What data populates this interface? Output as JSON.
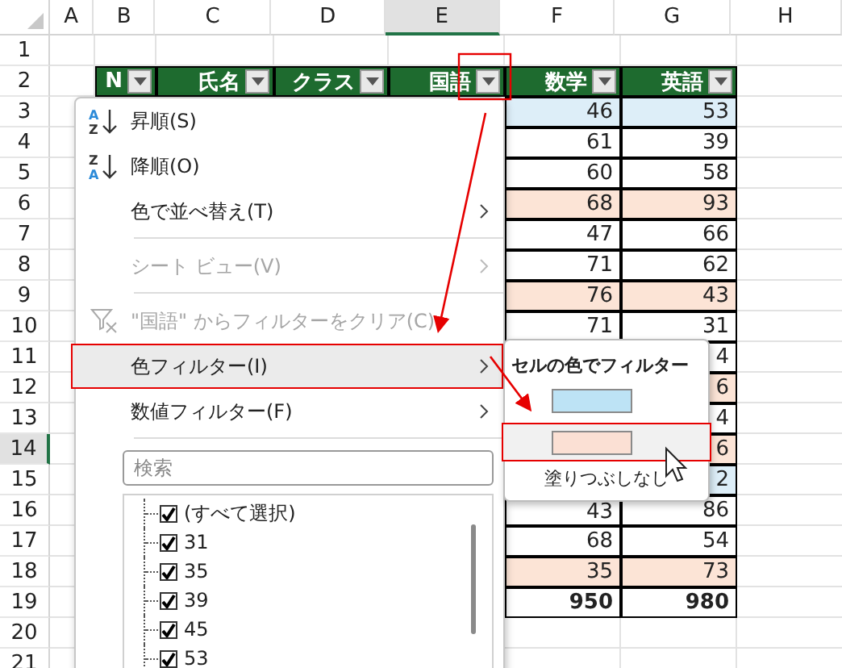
{
  "column_headers": [
    {
      "label": "A",
      "selected": false
    },
    {
      "label": "B",
      "selected": false
    },
    {
      "label": "C",
      "selected": false
    },
    {
      "label": "D",
      "selected": false
    },
    {
      "label": "E",
      "selected": true
    },
    {
      "label": "F",
      "selected": false
    },
    {
      "label": "G",
      "selected": false
    },
    {
      "label": "H",
      "selected": false
    }
  ],
  "row_numbers": [
    {
      "label": "1",
      "selected": false
    },
    {
      "label": "2",
      "selected": false
    },
    {
      "label": "3",
      "selected": false
    },
    {
      "label": "4",
      "selected": false
    },
    {
      "label": "5",
      "selected": false
    },
    {
      "label": "6",
      "selected": false
    },
    {
      "label": "7",
      "selected": false
    },
    {
      "label": "8",
      "selected": false
    },
    {
      "label": "9",
      "selected": false
    },
    {
      "label": "10",
      "selected": false
    },
    {
      "label": "11",
      "selected": false
    },
    {
      "label": "12",
      "selected": false
    },
    {
      "label": "13",
      "selected": false
    },
    {
      "label": "14",
      "selected": true
    },
    {
      "label": "15",
      "selected": false
    },
    {
      "label": "16",
      "selected": false
    },
    {
      "label": "17",
      "selected": false
    },
    {
      "label": "18",
      "selected": false
    },
    {
      "label": "19",
      "selected": false
    },
    {
      "label": "20",
      "selected": false
    },
    {
      "label": "21",
      "selected": false
    }
  ],
  "table": {
    "columns": [
      "N",
      "氏名",
      "クラス",
      "国語",
      "数学",
      "英語"
    ],
    "rows": [
      {
        "f": "46",
        "g": "53",
        "color": "#ddeef8"
      },
      {
        "f": "61",
        "g": "39"
      },
      {
        "f": "60",
        "g": "58"
      },
      {
        "f": "68",
        "g": "93",
        "color": "#fce4d6"
      },
      {
        "f": "47",
        "g": "66"
      },
      {
        "f": "71",
        "g": "62"
      },
      {
        "f": "76",
        "g": "43",
        "color": "#fce4d6"
      },
      {
        "f": "71",
        "g": "31"
      },
      {
        "g": "4"
      },
      {
        "g": "6",
        "color": "#fce4d6"
      },
      {
        "g": "4"
      },
      {
        "g": "6",
        "color": "#fce4d6"
      },
      {
        "g": "2",
        "color": "#ddeef8"
      },
      {
        "f": "43",
        "g": "86"
      },
      {
        "f": "68",
        "g": "54"
      },
      {
        "f": "35",
        "g": "73",
        "color": "#fce4d6"
      },
      {
        "f": "950",
        "g": "980",
        "kind": "total"
      }
    ]
  },
  "filter_menu": {
    "items": [
      {
        "kind": "sort_asc",
        "icon_top": "A",
        "icon_bottom": "Z",
        "label": "昇順(S)",
        "disabled": false,
        "highlighted": false,
        "submenu": false,
        "separator_after": false
      },
      {
        "kind": "sort_desc",
        "icon_top": "Z",
        "icon_bottom": "A",
        "label": "降順(O)",
        "disabled": false,
        "highlighted": false,
        "submenu": false,
        "separator_after": false
      },
      {
        "kind": "item",
        "label": "色で並べ替え(T)",
        "disabled": false,
        "highlighted": false,
        "submenu": true,
        "separator_after": true
      },
      {
        "kind": "item",
        "label": "シート ビュー(V)",
        "disabled": true,
        "highlighted": false,
        "submenu": true,
        "separator_after": true
      },
      {
        "kind": "clear",
        "label": "\"国語\" からフィルターをクリア(C)",
        "disabled": true,
        "highlighted": false,
        "submenu": false,
        "separator_after": false
      },
      {
        "kind": "item",
        "label": "色フィルター(I)",
        "disabled": false,
        "highlighted": true,
        "submenu": true,
        "separator_after": false
      },
      {
        "kind": "item",
        "label": "数値フィルター(F)",
        "disabled": false,
        "highlighted": false,
        "submenu": true,
        "separator_after": true
      }
    ],
    "search": {
      "placeholder": "検索"
    },
    "values": [
      {
        "label": "(すべて選択)",
        "checked": true
      },
      {
        "label": "31",
        "checked": true
      },
      {
        "label": "35",
        "checked": true
      },
      {
        "label": "39",
        "checked": true
      },
      {
        "label": "45",
        "checked": true
      },
      {
        "label": "53",
        "checked": true
      }
    ]
  },
  "color_submenu": {
    "title": "セルの色でフィルター",
    "swatches": [
      {
        "color": "#bde3f5",
        "selected": false
      },
      {
        "color": "#fbe0d4",
        "selected": true
      }
    ],
    "no_fill": "塗りつぶしなし"
  }
}
